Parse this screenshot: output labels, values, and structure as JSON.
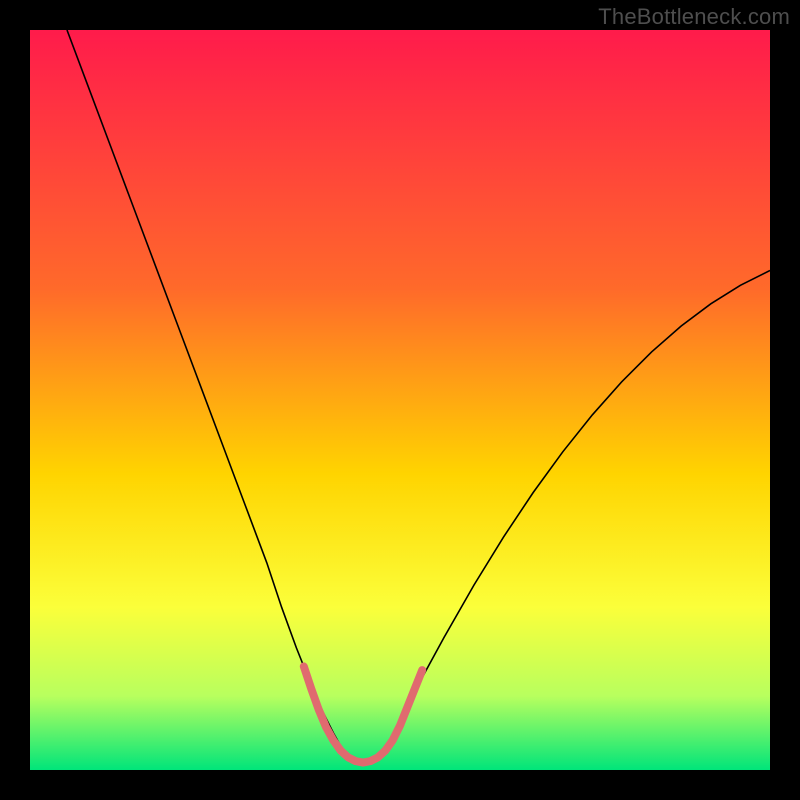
{
  "watermark": "TheBottleneck.com",
  "chart_data": {
    "type": "line",
    "title": "",
    "xlabel": "",
    "ylabel": "",
    "xlim": [
      0,
      100
    ],
    "ylim": [
      0,
      100
    ],
    "grid": false,
    "legend": false,
    "background_gradient": {
      "top": "#ff1b4b",
      "mid1": "#ff6a2a",
      "mid2": "#ffd400",
      "mid3": "#fbff3a",
      "mid4": "#b8ff5e",
      "bottom": "#00e57a"
    },
    "series": [
      {
        "name": "bottleneck_curve",
        "color": "#000000",
        "width": 1.6,
        "x": [
          5,
          8,
          11,
          14,
          17,
          20,
          23,
          26,
          29,
          32,
          34,
          36,
          38,
          39.5,
          41,
          42,
          43,
          44,
          45,
          46,
          47,
          48,
          49.5,
          51,
          53,
          56,
          60,
          64,
          68,
          72,
          76,
          80,
          84,
          88,
          92,
          96,
          100
        ],
        "y": [
          100,
          92,
          84,
          76,
          68,
          60,
          52,
          44,
          36,
          28,
          22,
          16.5,
          11.5,
          8,
          5,
          3.2,
          2,
          1.2,
          1,
          1.2,
          2,
          3.2,
          5.5,
          8.5,
          12.5,
          18,
          25,
          31.5,
          37.5,
          43,
          48,
          52.5,
          56.5,
          60,
          63,
          65.5,
          67.5
        ]
      },
      {
        "name": "highlight_band",
        "color": "#e06a6f",
        "width": 8,
        "linecap": "round",
        "x": [
          37,
          38,
          39,
          40,
          41,
          42,
          43,
          44,
          45,
          46,
          47,
          48,
          49,
          50,
          51,
          52,
          53
        ],
        "y": [
          14,
          11,
          8.2,
          5.8,
          4,
          2.6,
          1.7,
          1.2,
          1,
          1.2,
          1.7,
          2.6,
          4,
          6,
          8.5,
          11,
          13.5
        ]
      }
    ]
  }
}
